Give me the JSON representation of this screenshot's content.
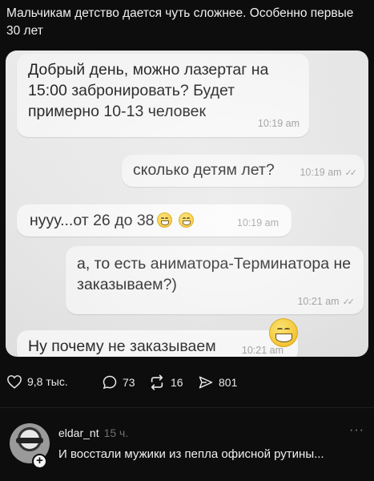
{
  "post": {
    "caption": "Мальчикам детство дается чуть сложнее. Особенно первые 30 лет"
  },
  "chat": {
    "messages": [
      {
        "text": "Добрый день, можно лазертаг на 15:00 забронировать? Будет примерно 10-13 человек",
        "time": "10:19 am"
      },
      {
        "text": "сколько детям лет?",
        "time": "10:19 am"
      },
      {
        "text": "нууу...от 26 до 38",
        "time": "10:19 am"
      },
      {
        "text": "а, то есть аниматора-Терминатора не заказываем?)",
        "time": "10:21 am"
      },
      {
        "text": "Ну почему не заказываем",
        "time": "10:21 am"
      }
    ],
    "checks": "✓✓"
  },
  "actions": {
    "likes": "9,8 тыс.",
    "comments": "73",
    "reposts": "16",
    "shares": "801"
  },
  "comment": {
    "username": "eldar_nt",
    "time": "15 ч.",
    "text": "И восстали мужики из пепла офисной рутины...",
    "more": "···"
  },
  "colors": {
    "background": "#0d0d0d",
    "emoji": "#f4b400"
  }
}
